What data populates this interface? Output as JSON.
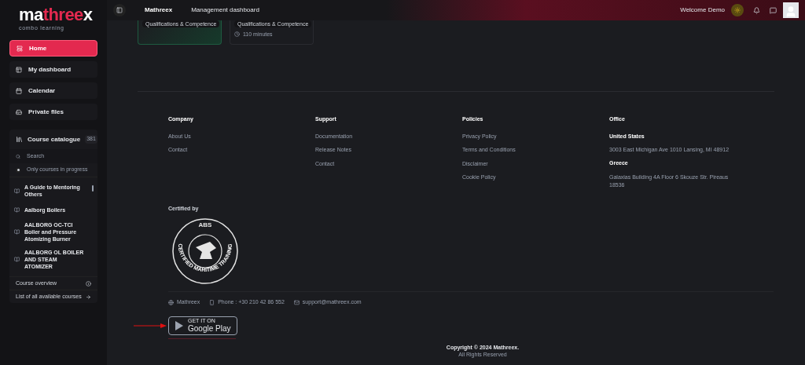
{
  "logo": {
    "lead": "ma",
    "accent": "three",
    "tail": "x",
    "tagline": "combo learning"
  },
  "nav": [
    {
      "label": "Home",
      "selected": true
    },
    {
      "label": "My dashboard",
      "selected": false
    },
    {
      "label": "Calendar",
      "selected": false
    },
    {
      "label": "Private files",
      "selected": false
    }
  ],
  "catalogue": {
    "title": "Course catalogue",
    "count": "381",
    "search_placeholder": "Search",
    "filter": {
      "label": "Only courses in progress",
      "checked": true
    },
    "courses": [
      "A Guide to Mentoring Others",
      "Aalborg Boilers",
      "AALBORG OC-TCI Boiler and Pressure Atomizing Burner",
      "AALBORG OL BOILER AND STEAM ATOMIZER"
    ],
    "links": [
      {
        "label": "Course overview",
        "kind": "info"
      },
      {
        "label": "List of all available courses",
        "kind": "arrow"
      }
    ]
  },
  "header": {
    "breadcrumbs": [
      "Mathreex",
      "Management dashboard"
    ],
    "welcome": "Welcome Demo"
  },
  "cards": [
    {
      "tag": "Qualifications & Competence",
      "kind": "green"
    },
    {
      "tag": "Qualifications & Competence",
      "duration": "110 minutes",
      "kind": "plain"
    }
  ],
  "footer": {
    "columns": [
      {
        "title": "Company",
        "links": [
          "About Us",
          "Contact"
        ]
      },
      {
        "title": "Support",
        "links": [
          "Documentation",
          "Release Notes",
          "Contact"
        ]
      },
      {
        "title": "Policies",
        "links": [
          "Privacy Policy",
          "Terms and Conditions",
          "Disclaimer",
          "Cookie Policy"
        ]
      }
    ],
    "office": {
      "title": "Office",
      "entries": [
        {
          "country": "United States",
          "address": "3003 East Michigan Ave 1010 Lansing, MI 48912"
        },
        {
          "country": "Greece",
          "address": "Galaxias Building 4A Floor 6 Skouze Str. Pireaus 18536"
        }
      ]
    },
    "certified": {
      "label": "Certified by",
      "seal_top": "ABS",
      "seal_ring": "CERTIFIED MARITIME TRAINING"
    },
    "contacts": [
      {
        "kind": "web",
        "text": "Mathreex"
      },
      {
        "kind": "phone",
        "text": "Phone : +30 210 42 86 552"
      },
      {
        "kind": "mail",
        "text": "support@mathreex.com"
      }
    ],
    "store": {
      "small": "GET IT ON",
      "big": "Google Play"
    },
    "copyright": [
      "Copyright © 2024 Mathreex.",
      "All Rights Reserved"
    ]
  }
}
